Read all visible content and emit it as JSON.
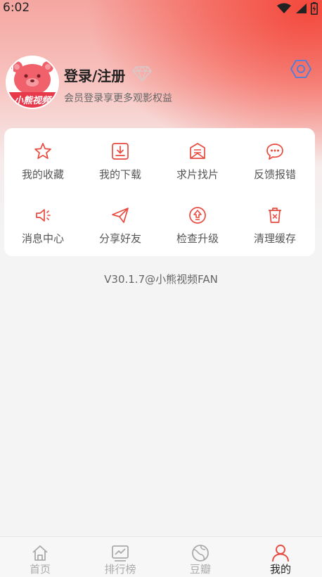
{
  "status_bar": {
    "time": "6:02"
  },
  "profile": {
    "avatar_text": "小熊视频",
    "title": "登录/注册",
    "subtitle": "会员登录享更多观影权益"
  },
  "menu": [
    {
      "label": "我的收藏",
      "icon": "star-icon"
    },
    {
      "label": "我的下载",
      "icon": "download-icon"
    },
    {
      "label": "求片找片",
      "icon": "request-icon"
    },
    {
      "label": "反馈报错",
      "icon": "feedback-icon"
    },
    {
      "label": "消息中心",
      "icon": "speaker-icon"
    },
    {
      "label": "分享好友",
      "icon": "share-icon"
    },
    {
      "label": "检查升级",
      "icon": "upgrade-icon"
    },
    {
      "label": "清理缓存",
      "icon": "trash-icon"
    }
  ],
  "version": "V30.1.7@小熊视频FAN",
  "bottom_nav": [
    {
      "label": "首页",
      "icon": "home-icon",
      "active": false
    },
    {
      "label": "排行榜",
      "icon": "chart-icon",
      "active": false
    },
    {
      "label": "豆瓣",
      "icon": "planet-icon",
      "active": false
    },
    {
      "label": "我的",
      "icon": "user-icon",
      "active": true
    }
  ],
  "colors": {
    "accent": "#e84a3f",
    "nav_inactive": "#aaaaaa",
    "nav_active": "#222222",
    "settings_blue": "#4a7fe0"
  }
}
